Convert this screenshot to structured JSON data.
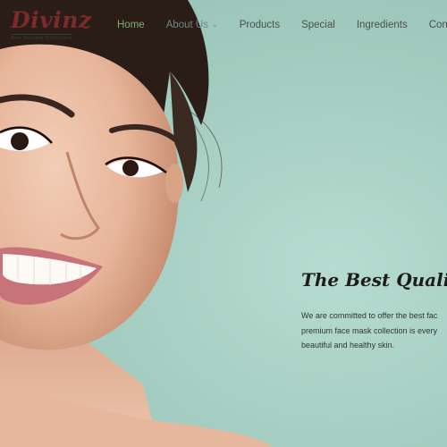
{
  "brand": {
    "name": "Divinz",
    "tagline": "New Zealand Collection",
    "color": "#7c2a2a"
  },
  "nav": {
    "items": [
      {
        "label": "Home",
        "active": true
      },
      {
        "label": "About Us",
        "dropdown": true
      },
      {
        "label": "Products"
      },
      {
        "label": "Special"
      },
      {
        "label": "Ingredients"
      },
      {
        "label": "Contac"
      }
    ],
    "active_color": "#7bb06f"
  },
  "hero": {
    "headline": "The Best Quality",
    "copy_lines": [
      "We are committed to offer the best fac",
      "premium face mask collection is every",
      "beautiful and healthy skin."
    ],
    "background_color": "#a6cec2"
  },
  "icons": {
    "dropdown": "chevron-down-icon"
  }
}
